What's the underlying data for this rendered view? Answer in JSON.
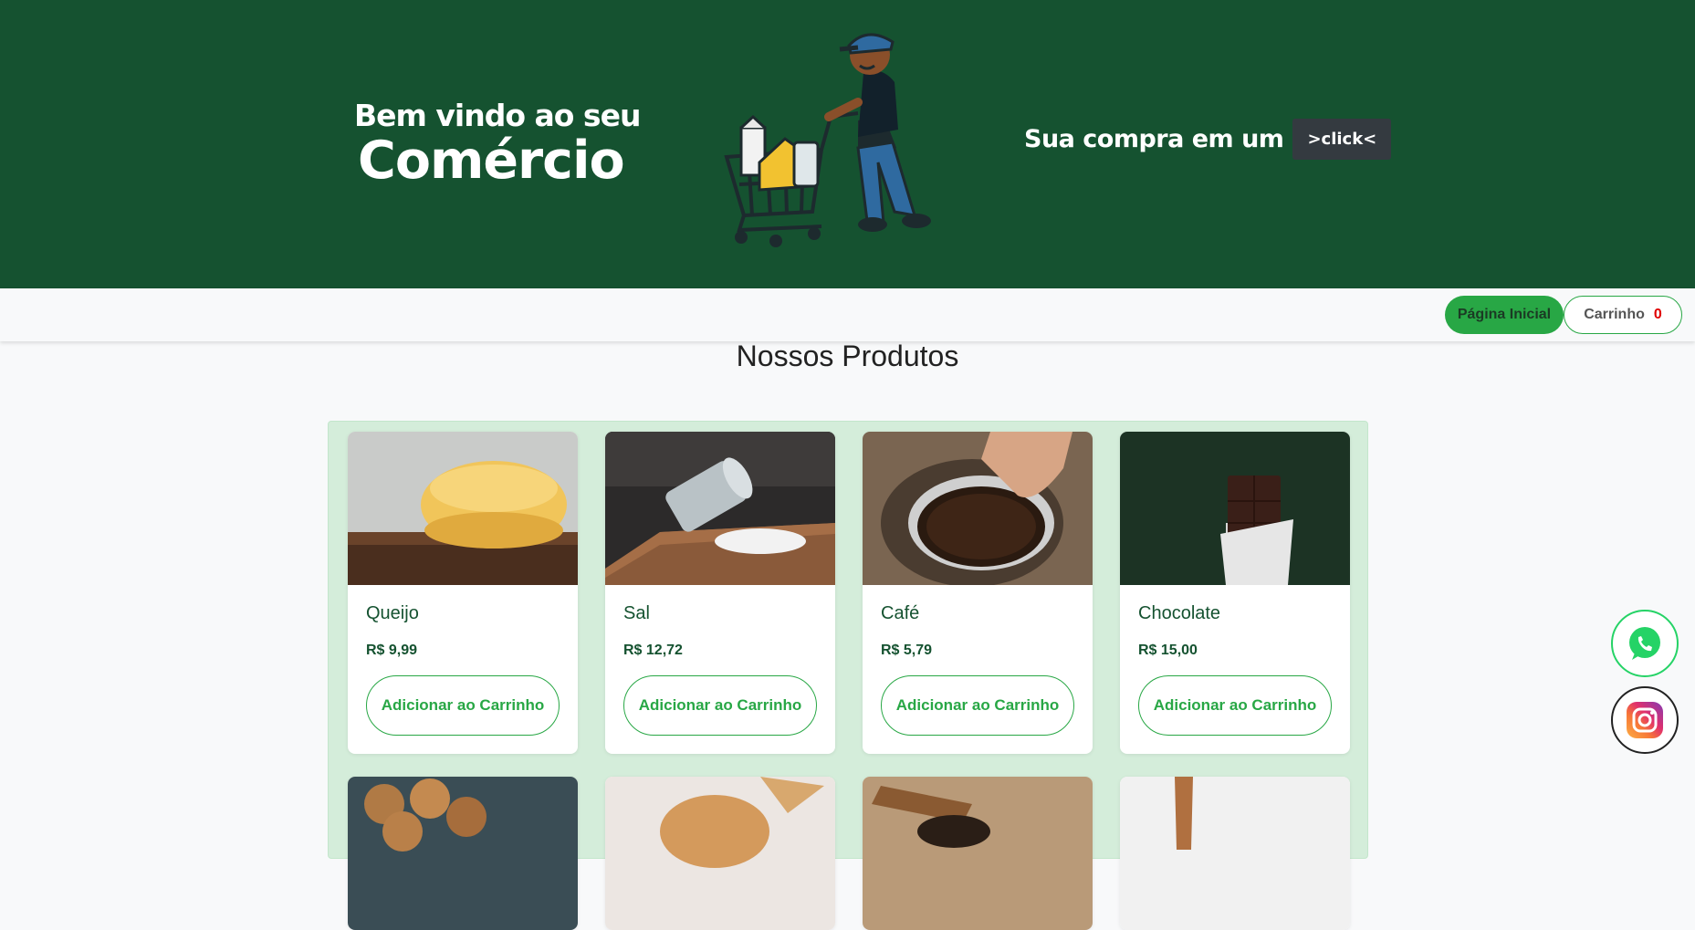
{
  "banner": {
    "welcome_line1": "Bem vindo ao seu",
    "welcome_line2": "Comércio",
    "tagline": "Sua compra em um",
    "click_badge": ">click<"
  },
  "nav": {
    "home_label": "Página Inicial",
    "cart_label": "Carrinho",
    "cart_count": "0"
  },
  "section_title": "Nossos Produtos",
  "products": [
    {
      "name": "Queijo",
      "price": "R$ 9,99",
      "button": "Adicionar ao Carrinho"
    },
    {
      "name": "Sal",
      "price": "R$ 12,72",
      "button": "Adicionar ao Carrinho"
    },
    {
      "name": "Café",
      "price": "R$ 5,79",
      "button": "Adicionar ao Carrinho"
    },
    {
      "name": "Chocolate",
      "price": "R$ 15,00",
      "button": "Adicionar ao Carrinho"
    }
  ],
  "colors": {
    "banner_bg": "#155230",
    "accent_green": "#28a745",
    "cart_count": "#e00000",
    "products_bg": "#d4edda"
  },
  "icons": [
    "whatsapp-icon",
    "instagram-icon"
  ]
}
